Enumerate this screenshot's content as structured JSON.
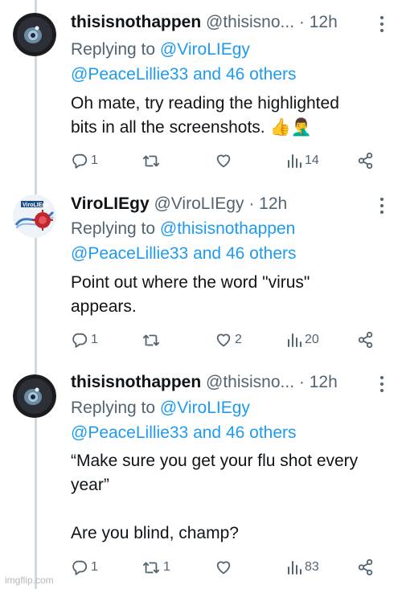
{
  "tweets": [
    {
      "name": "thisisnothappen",
      "handle": "@thisisno...",
      "time": "· 12h",
      "replying_prefix": "Replying to ",
      "replying_to_1": "@ViroLIEgy",
      "replying_to_2": "@PeaceLillie33 and 46 others",
      "text_lines": [
        "Oh mate, try reading the highlighted",
        "bits in all the screenshots. 👍🤦‍♂️"
      ],
      "replies": "1",
      "retweets": "",
      "likes": "",
      "views": "14",
      "avatar": "eye-avatar"
    },
    {
      "name": "ViroLIEgy",
      "handle": "@ViroLIEgy",
      "time": "· 12h",
      "replying_prefix": "Replying to ",
      "replying_to_1": "@thisisnothappen",
      "replying_to_2": "@PeaceLillie33 and 46 others",
      "text_lines": [
        "Point out where the word \"virus\"",
        "appears."
      ],
      "replies": "1",
      "retweets": "",
      "likes": "2",
      "views": "20",
      "avatar": "virus-logo-avatar"
    },
    {
      "name": "thisisnothappen",
      "handle": "@thisisno...",
      "time": "· 12h",
      "replying_prefix": "Replying to ",
      "replying_to_1": "@ViroLIEgy",
      "replying_to_2": "@PeaceLillie33 and 46 others",
      "text_lines": [
        "“Make sure you get your flu shot every",
        "year”",
        "",
        "Are you blind, champ?"
      ],
      "replies": "1",
      "retweets": "1",
      "likes": "",
      "views": "83",
      "avatar": "eye-avatar"
    }
  ],
  "watermark": "imgflip.com",
  "colors": {
    "link": "#1d9bf0",
    "secondary": "#536471",
    "text": "#0f1419",
    "thread_line": "#cfd9de"
  },
  "icons": [
    "reply-icon",
    "retweet-icon",
    "like-icon",
    "views-icon",
    "share-icon",
    "more-icon"
  ]
}
